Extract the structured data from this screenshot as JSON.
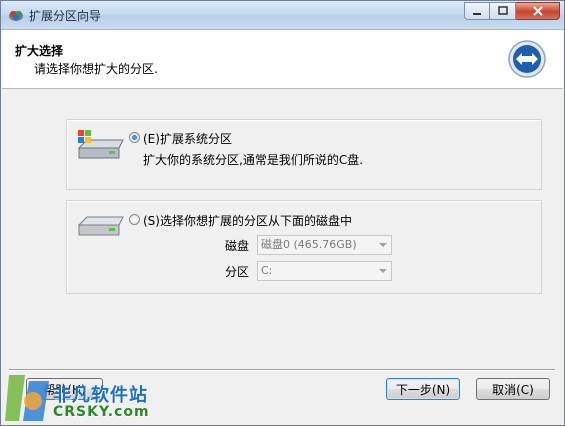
{
  "window": {
    "title": "扩展分区向导"
  },
  "header": {
    "title": "扩大选择",
    "subtitle": "请选择你想扩大的分区."
  },
  "option1": {
    "label": "(E)扩展系统分区",
    "description": "扩大你的系统分区,通常是我们所说的C盘.",
    "selected": true
  },
  "option2": {
    "label": "(S)选择你想扩展的分区从下面的磁盘中",
    "selected": false,
    "disk_label": "磁盘",
    "disk_value": "磁盘0 (465.76GB)",
    "partition_label": "分区",
    "partition_value": "C:"
  },
  "buttons": {
    "help": "帮助(H)",
    "next": "下一步(N)",
    "cancel": "取消(C)"
  },
  "watermark": {
    "text_cn": "非凡软件站",
    "text_en": "CRSKY.com"
  },
  "colors": {
    "title_bar": "#c7daf0",
    "close_button": "#c7442c",
    "body": "#f0f0f0",
    "header": "#ffffff"
  }
}
